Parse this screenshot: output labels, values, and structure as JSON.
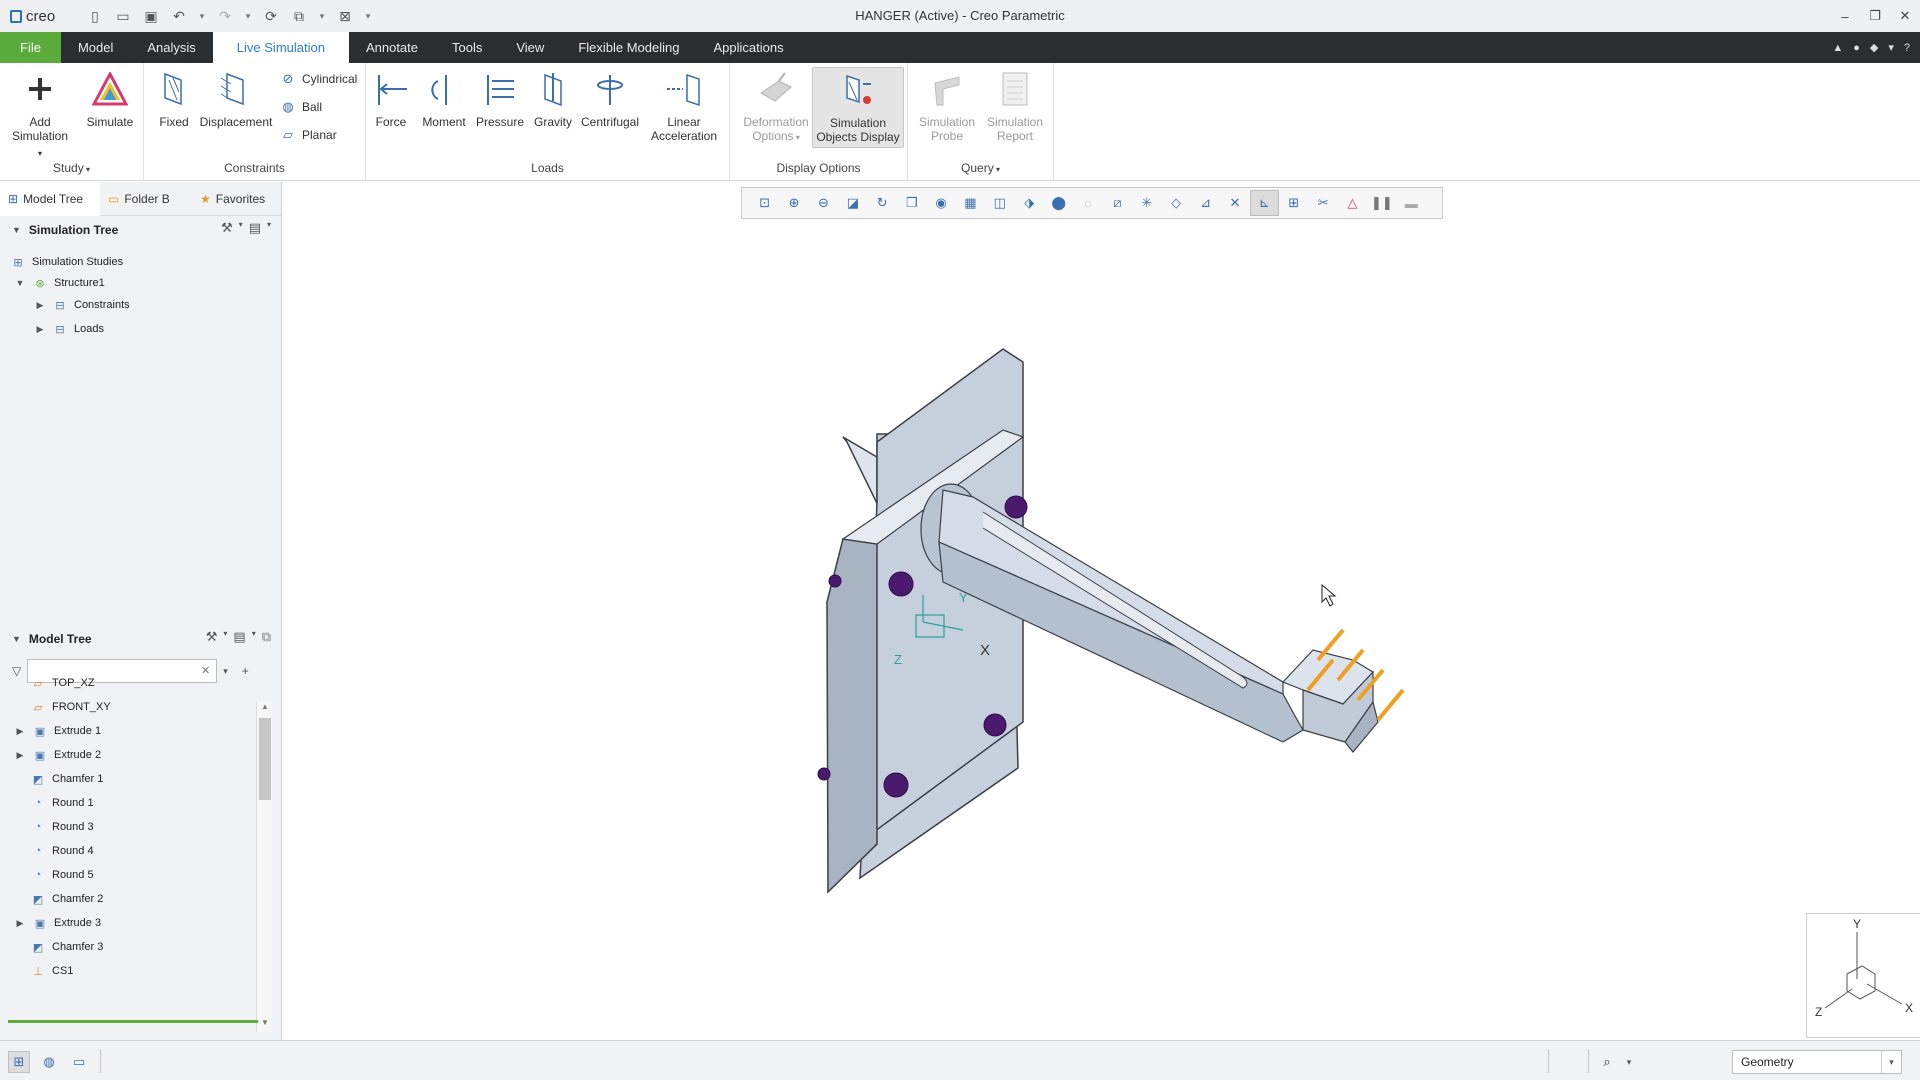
{
  "app": {
    "window_title": "HANGER (Active) - Creo Parametric",
    "logo_text": "creo"
  },
  "ribbon_tabs": [
    {
      "label": "File"
    },
    {
      "label": "Model"
    },
    {
      "label": "Analysis"
    },
    {
      "label": "Live Simulation",
      "active": true
    },
    {
      "label": "Annotate"
    },
    {
      "label": "Tools"
    },
    {
      "label": "View"
    },
    {
      "label": "Flexible Modeling"
    },
    {
      "label": "Applications"
    }
  ],
  "ribbon": {
    "study": {
      "label": "Study",
      "add_simulation": "Add Simulation",
      "simulate": "Simulate"
    },
    "constraints": {
      "label": "Constraints",
      "fixed": "Fixed",
      "displacement": "Displacement",
      "cylindrical": "Cylindrical",
      "ball": "Ball",
      "planar": "Planar"
    },
    "loads": {
      "label": "Loads",
      "force": "Force",
      "moment": "Moment",
      "pressure": "Pressure",
      "gravity": "Gravity",
      "centrifugal": "Centrifugal",
      "linear_acceleration": "Linear Acceleration"
    },
    "display_options": {
      "label": "Display Options",
      "deformation_options": "Deformation Options",
      "simulation_objects_display": "Simulation Objects Display"
    },
    "query": {
      "label": "Query",
      "simulation_probe": "Simulation Probe",
      "simulation_report": "Simulation Report"
    }
  },
  "left_panel": {
    "tabs": [
      {
        "label": "Model Tree"
      },
      {
        "label": "Folder B"
      },
      {
        "label": "Favorites"
      }
    ],
    "simulation_tree": {
      "header": "Simulation Tree",
      "items": [
        {
          "label": "Simulation Studies"
        },
        {
          "label": "Structure1"
        },
        {
          "label": "Constraints"
        },
        {
          "label": "Loads"
        }
      ]
    },
    "model_tree": {
      "header": "Model Tree",
      "filter_placeholder": "",
      "items": [
        {
          "label": "TOP_XZ"
        },
        {
          "label": "FRONT_XY"
        },
        {
          "label": "Extrude 1"
        },
        {
          "label": "Extrude 2"
        },
        {
          "label": "Chamfer 1"
        },
        {
          "label": "Round 1"
        },
        {
          "label": "Round 3"
        },
        {
          "label": "Round 4"
        },
        {
          "label": "Round 5"
        },
        {
          "label": "Chamfer 2"
        },
        {
          "label": "Extrude 3"
        },
        {
          "label": "Chamfer 3"
        },
        {
          "label": "CS1"
        }
      ]
    }
  },
  "graphics": {
    "csys_labels": {
      "x": "X",
      "y": "Y",
      "z": "Z"
    }
  },
  "status_bar": {
    "selection_filter": "Geometry"
  },
  "colors": {
    "file_tab": "#5bab3c",
    "active_tab_text": "#2e7dd1",
    "tab_bar": "#2b2d30",
    "constraint_markers": "#4b1a6e",
    "load_arrows": "#f0a020",
    "model_surface": "#c9d3e0"
  }
}
